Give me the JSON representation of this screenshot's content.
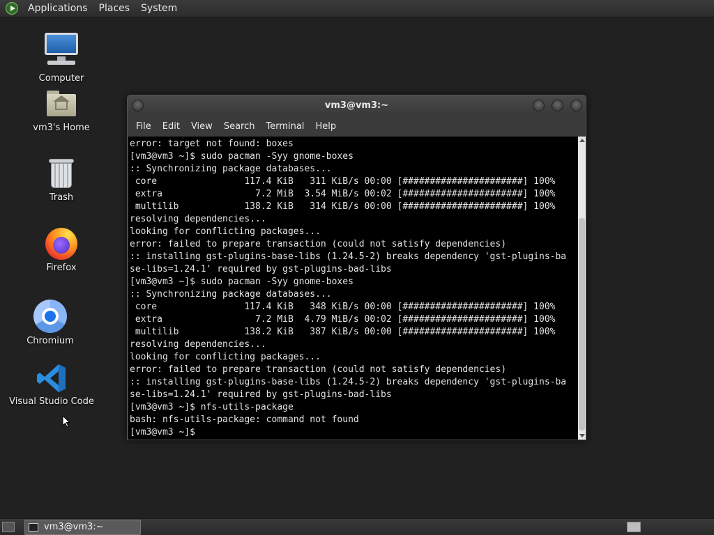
{
  "top_panel": {
    "menus": [
      "Applications",
      "Places",
      "System"
    ]
  },
  "desktop": {
    "icons": [
      {
        "label": "Computer",
        "icon": "computer-icon"
      },
      {
        "label": "vm3's Home",
        "icon": "home-folder-icon"
      },
      {
        "label": "Trash",
        "icon": "trash-icon"
      },
      {
        "label": "Firefox",
        "icon": "firefox-icon"
      },
      {
        "label": "Chromium",
        "icon": "chromium-icon"
      },
      {
        "label": "Visual Studio Code",
        "icon": "vscode-icon"
      }
    ]
  },
  "terminal": {
    "title": "vm3@vm3:~",
    "menu": [
      "File",
      "Edit",
      "View",
      "Search",
      "Terminal",
      "Help"
    ],
    "lines": [
      "error: target not found: boxes",
      "[vm3@vm3 ~]$ sudo pacman -Syy gnome-boxes",
      ":: Synchronizing package databases...",
      " core                117.4 KiB   311 KiB/s 00:00 [######################] 100%",
      " extra                 7.2 MiB  3.54 MiB/s 00:02 [######################] 100%",
      " multilib            138.2 KiB   314 KiB/s 00:00 [######################] 100%",
      "resolving dependencies...",
      "looking for conflicting packages...",
      "error: failed to prepare transaction (could not satisfy dependencies)",
      ":: installing gst-plugins-base-libs (1.24.5-2) breaks dependency 'gst-plugins-ba",
      "se-libs=1.24.1' required by gst-plugins-bad-libs",
      "[vm3@vm3 ~]$ sudo pacman -Syy gnome-boxes",
      ":: Synchronizing package databases...",
      " core                117.4 KiB   348 KiB/s 00:00 [######################] 100%",
      " extra                 7.2 MiB  4.79 MiB/s 00:02 [######################] 100%",
      " multilib            138.2 KiB   387 KiB/s 00:00 [######################] 100%",
      "resolving dependencies...",
      "looking for conflicting packages...",
      "error: failed to prepare transaction (could not satisfy dependencies)",
      ":: installing gst-plugins-base-libs (1.24.5-2) breaks dependency 'gst-plugins-ba",
      "se-libs=1.24.1' required by gst-plugins-bad-libs",
      "[vm3@vm3 ~]$ nfs-utils-package",
      "bash: nfs-utils-package: command not found",
      "[vm3@vm3 ~]$"
    ]
  },
  "taskbar": {
    "task_label": "vm3@vm3:~"
  }
}
